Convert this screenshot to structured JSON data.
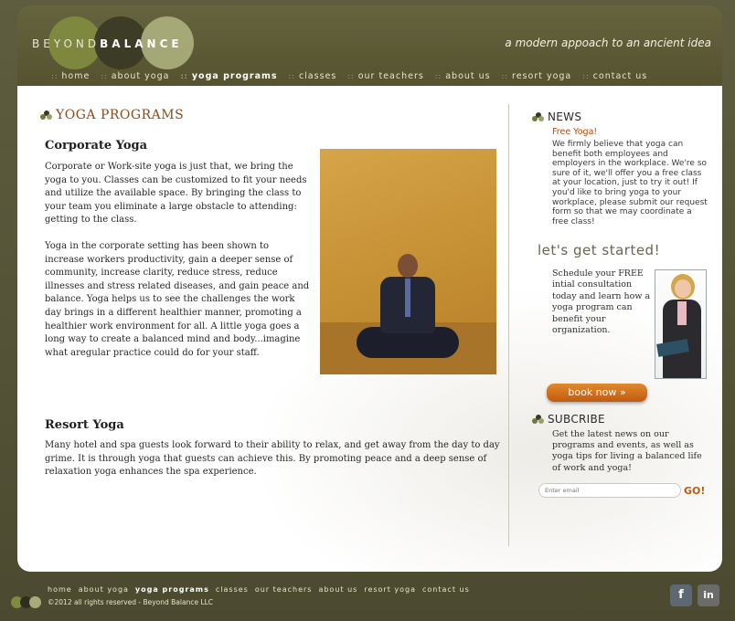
{
  "header": {
    "logo_left": "BEYOND",
    "logo_right": "BALANCE",
    "tagline": "a modern appoach to an ancient idea"
  },
  "nav": [
    {
      "label": "home"
    },
    {
      "label": "about yoga"
    },
    {
      "label": "yoga programs",
      "active": true
    },
    {
      "label": "classes"
    },
    {
      "label": "our teachers"
    },
    {
      "label": "about us"
    },
    {
      "label": "resort yoga"
    },
    {
      "label": "contact us"
    }
  ],
  "main": {
    "page_title": "YOGA PROGRAMS",
    "corporate": {
      "heading": "Corporate Yoga",
      "para1": "Corporate or Work-site yoga is just that, we bring the yoga to you. Classes can be customized to fit your needs and utilize the available space. By bringing the class to your team you eliminate a large obstacle to attending: getting to the class.",
      "para2": "Yoga in the corporate setting has been shown to increase workers productivity, gain a deeper sense of community, increase clarity, reduce stress, reduce illnesses and stress related diseases, and gain peace and balance. Yoga helps us to see the challenges the work day brings in a different healthier manner, promoting a healthier work environment for all.  A little yoga goes a long way to create a balanced mind and body...imagine what aregular practice could do for your staff."
    },
    "resort": {
      "heading": "Resort Yoga",
      "para": "Many hotel and spa guests look forward to their ability to relax, and get away from the day to day grime. It is through yoga that guests can achieve this. By promoting peace and a deep sense of relaxation yoga enhances the spa experience."
    }
  },
  "sidebar": {
    "news_title": "NEWS",
    "news_subtitle": "Free Yoga!",
    "news_text": "We firmly believe that yoga can benefit both employees and employers in the workplace. We're so sure of it, we'll offer you a free class at your location, just to try it out! If you'd like to bring yoga to your workplace, please submit our request form so that we may coordinate a free class!",
    "lets_get_started": "let's get started!",
    "schedule_text": "Schedule your FREE intial consultation today and learn how a yoga program can benefit your organization.",
    "book_button": "book now »",
    "subscribe_title": "SUBCRIBE",
    "subscribe_text": "Get the latest news on our programs and events, as well as yoga tips for living a balanced life of work and yoga!",
    "email_placeholder": "Enter email",
    "go_label": "GO!"
  },
  "footer": {
    "links": [
      {
        "label": "home"
      },
      {
        "label": "about yoga"
      },
      {
        "label": "yoga programs",
        "active": true
      },
      {
        "label": "classes"
      },
      {
        "label": "our teachers"
      },
      {
        "label": "about us"
      },
      {
        "label": "resort yoga"
      },
      {
        "label": "contact us"
      }
    ],
    "copyright": "©2012 all rights reserved - Beyond Balance LLC",
    "social": [
      {
        "icon": "facebook-icon",
        "glyph": "f"
      },
      {
        "icon": "linkedin-icon",
        "glyph": "in"
      }
    ]
  }
}
